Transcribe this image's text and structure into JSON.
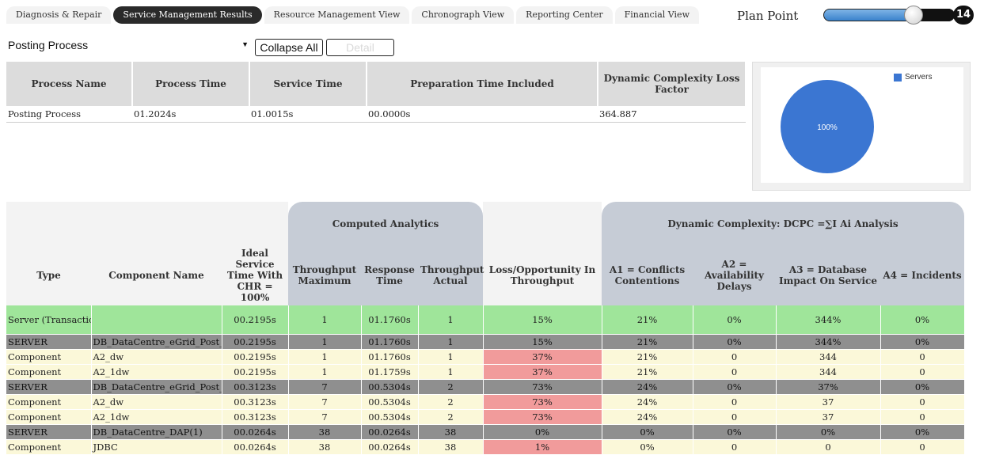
{
  "tabs": [
    {
      "label": "Diagnosis & Repair",
      "active": false
    },
    {
      "label": "Service Management Results",
      "active": true
    },
    {
      "label": "Resource Management View",
      "active": false
    },
    {
      "label": "Chronograph View",
      "active": false
    },
    {
      "label": "Reporting Center",
      "active": false
    },
    {
      "label": "Financial View",
      "active": false
    }
  ],
  "plan_point": {
    "label": "Plan Point",
    "value": "14"
  },
  "controls": {
    "process_select_value": "Posting Process",
    "collapse_label": "Collapse All",
    "detail_label": "Detail"
  },
  "process_table": {
    "headers": [
      "Process Name",
      "Process Time",
      "Service Time",
      "Preparation Time Included",
      "Dynamic Complexity Loss Factor"
    ],
    "row": [
      "Posting Process",
      "01.2024s",
      "01.0015s",
      "00.0000s",
      "364.887"
    ]
  },
  "pie": {
    "legend": "Servers",
    "label": "100%",
    "color": "#3b76d2"
  },
  "analytics": {
    "group_headers": {
      "computed": "Computed Analytics",
      "dynamic": "Dynamic Complexity: DCPC =∑I Ai Analysis"
    },
    "headers": [
      "Type",
      "Component Name",
      "Ideal Service Time With CHR = 100%",
      "Throughput Maximum",
      "Response Time",
      "Throughput Actual",
      "Loss/Opportunity In Throughput",
      "A1 = Conflicts Contentions",
      "A2 = Availability Delays",
      "A3 = Database Impact On Service",
      "A4 = Incidents"
    ],
    "rows": [
      {
        "kind": "green",
        "cells": [
          "Server (Transactional)",
          "",
          "00.2195s",
          "1",
          "01.1760s",
          "1",
          "15%",
          "21%",
          "0%",
          "344%",
          "0%"
        ]
      },
      {
        "kind": "server",
        "cells": [
          "SERVER",
          "DB_DataCentre_eGrid_Post_A",
          "00.2195s",
          "1",
          "01.1760s",
          "1",
          "15%",
          "21%",
          "0%",
          "344%",
          "0%"
        ]
      },
      {
        "kind": "comp",
        "cells": [
          "Component",
          "A2_dw",
          "00.2195s",
          "1",
          "01.1760s",
          "1",
          "37%",
          "21%",
          "0",
          "344",
          "0"
        ]
      },
      {
        "kind": "comp",
        "cells": [
          "Component",
          "A2_1dw",
          "00.2195s",
          "1",
          "01.1759s",
          "1",
          "37%",
          "21%",
          "0",
          "344",
          "0"
        ]
      },
      {
        "kind": "server",
        "cells": [
          "SERVER",
          "DB_DataCentre_eGrid_Post_B",
          "00.3123s",
          "7",
          "00.5304s",
          "2",
          "73%",
          "24%",
          "0%",
          "37%",
          "0%"
        ]
      },
      {
        "kind": "comp",
        "cells": [
          "Component",
          "A2_dw",
          "00.3123s",
          "7",
          "00.5304s",
          "2",
          "73%",
          "24%",
          "0",
          "37",
          "0"
        ]
      },
      {
        "kind": "comp",
        "cells": [
          "Component",
          "A2_1dw",
          "00.3123s",
          "7",
          "00.5304s",
          "2",
          "73%",
          "24%",
          "0",
          "37",
          "0"
        ]
      },
      {
        "kind": "server",
        "cells": [
          "SERVER",
          "DB_DataCentre_DAP(1)",
          "00.0264s",
          "38",
          "00.0264s",
          "38",
          "0%",
          "0%",
          "0%",
          "0%",
          "0%"
        ]
      },
      {
        "kind": "comp",
        "cells": [
          "Component",
          "JDBC",
          "00.0264s",
          "38",
          "00.0264s",
          "38",
          "1%",
          "0%",
          "0",
          "0",
          "0"
        ]
      }
    ]
  }
}
